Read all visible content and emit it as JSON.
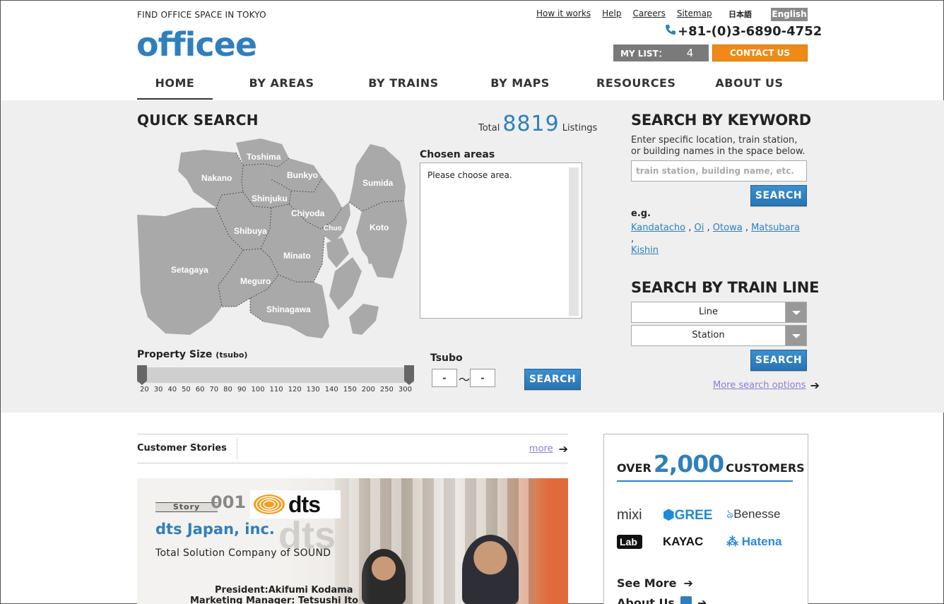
{
  "header": {
    "tagline": "FIND OFFICE SPACE IN TOKYO",
    "logo": "officee",
    "links": [
      "How it works",
      "Help",
      "Careers",
      "Sitemap"
    ],
    "lang_jp": "日本語",
    "lang_en": "English",
    "phone": "+81-(0)3-6890-4752",
    "mylist_label": "MY LIST：",
    "mylist_count": "4",
    "contact": "CONTACT US"
  },
  "nav": [
    "HOME",
    "BY AREAS",
    "BY TRAINS",
    "BY MAPS",
    "RESOURCES",
    "ABOUT US"
  ],
  "quick_search": {
    "title": "QUICK SEARCH",
    "total_label": "Total",
    "total_count": "8819",
    "listings_label": "Listings",
    "areas": [
      "Toshima",
      "Nakano",
      "Bunkyo",
      "Sumida",
      "Shinjuku",
      "Chiyoda",
      "Chuo",
      "Koto",
      "Shibuya",
      "Minato",
      "Setagaya",
      "Meguro",
      "Shinagawa"
    ],
    "chosen_label": "Chosen areas",
    "chosen_placeholder": "Please choose area.",
    "size_label": "Property Size",
    "size_unit": "(tsubo)",
    "ticks": [
      "20",
      "30",
      "40",
      "50",
      "60",
      "70",
      "80",
      "90",
      "100",
      "110",
      "120",
      "130",
      "140",
      "150",
      "200",
      "250",
      "300"
    ],
    "tsubo_label": "Tsubo",
    "tsubo_from": "-",
    "tsubo_to": "-",
    "tilde": "〜",
    "search": "SEARCH"
  },
  "keyword": {
    "title": "SEARCH BY KEYWORD",
    "desc": "Enter specific location, train station, or building names in the space below.",
    "placeholder": "train station, building name, etc.",
    "search": "SEARCH",
    "eg": "e.g.",
    "examples": [
      "Kandatacho",
      "Oi",
      "Otowa",
      "Matsubara",
      "Kishin"
    ]
  },
  "train": {
    "title": "SEARCH BY TRAIN LINE",
    "line": "Line",
    "station": "Station",
    "search": "SEARCH",
    "more": "More search options"
  },
  "stories": {
    "title": "Customer Stories",
    "more": "more",
    "story_tag": "Story",
    "story_num": "001",
    "logo": "dts",
    "company": "dts Japan, inc.",
    "subtitle": "Total Solution Company of SOUND",
    "person1": "President:Akifumi Kodama",
    "person2": "Marketing Manager: Tetsushi Ito"
  },
  "customers": {
    "over": "OVER",
    "count": "2,000",
    "label": "CUSTOMERS",
    "logos": [
      "mixi",
      "GREE",
      "Benesse",
      "Lab",
      "KAYAC",
      "Hatena"
    ],
    "see_more": "See More",
    "about_us": "About Us"
  },
  "colors": {
    "brand_blue": "#2f7fbd",
    "contact_orange": "#f08a16",
    "band_gray": "#efefef"
  }
}
